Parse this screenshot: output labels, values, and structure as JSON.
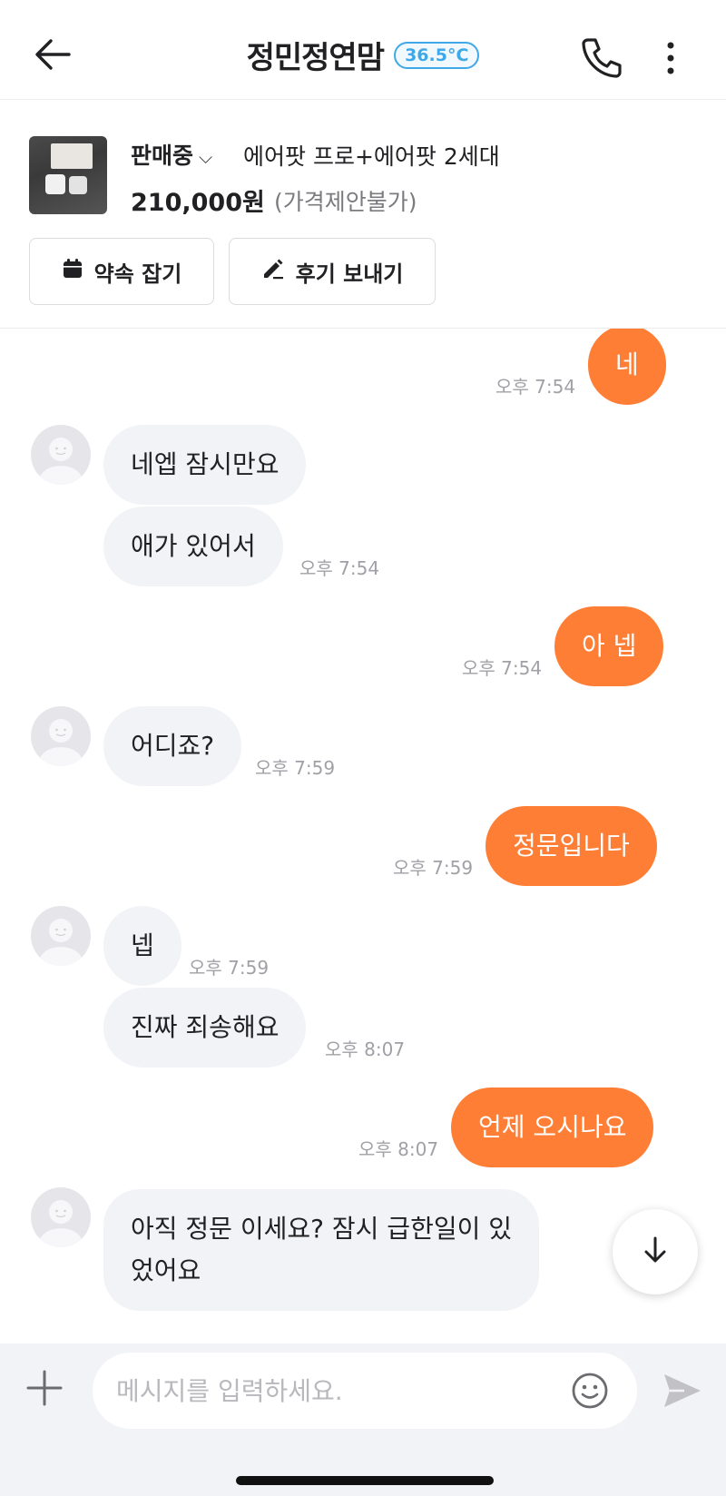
{
  "header": {
    "title": "정민정연맘",
    "manner_temp": "36.5°C",
    "icons": {
      "back": "back-arrow-icon",
      "phone": "phone-icon",
      "more": "more-vertical-icon"
    }
  },
  "product": {
    "status": "판매중",
    "status_chevron": "⌵",
    "name": "에어팟 프로+에어팟 2세대",
    "price": "210,000원",
    "price_note": "(가격제안불가)",
    "appointment_label": "약속 잡기",
    "review_label": "후기 보내기"
  },
  "messages": [
    {
      "dir": "out",
      "text": "네",
      "time": "오후 7:54"
    },
    {
      "dir": "in",
      "text": "네엡 잠시만요",
      "time": ""
    },
    {
      "dir": "in",
      "text": "애가 있어서",
      "time": "오후 7:54"
    },
    {
      "dir": "out",
      "text": "아 넵",
      "time": "오후 7:54"
    },
    {
      "dir": "in",
      "text": "어디죠?",
      "time": "오후 7:59"
    },
    {
      "dir": "out",
      "text": "정문입니다",
      "time": "오후 7:59"
    },
    {
      "dir": "in",
      "text": "넵",
      "time": "오후 7:59"
    },
    {
      "dir": "in",
      "text": "진짜 죄송해요",
      "time": "오후 8:07"
    },
    {
      "dir": "out",
      "text": "언제 오시나요",
      "time": "오후 8:07"
    },
    {
      "dir": "in",
      "text_line1": "아직 정문 이세요? 잠시 급한일이 있",
      "text_line2": "었어요",
      "time": ""
    }
  ],
  "input": {
    "placeholder": "메시지를 입력하세요.",
    "value": ""
  },
  "colors": {
    "accent": "#ff7e36",
    "incoming_bubble": "#f2f3f6",
    "temp_badge": "#3fa8e8"
  }
}
